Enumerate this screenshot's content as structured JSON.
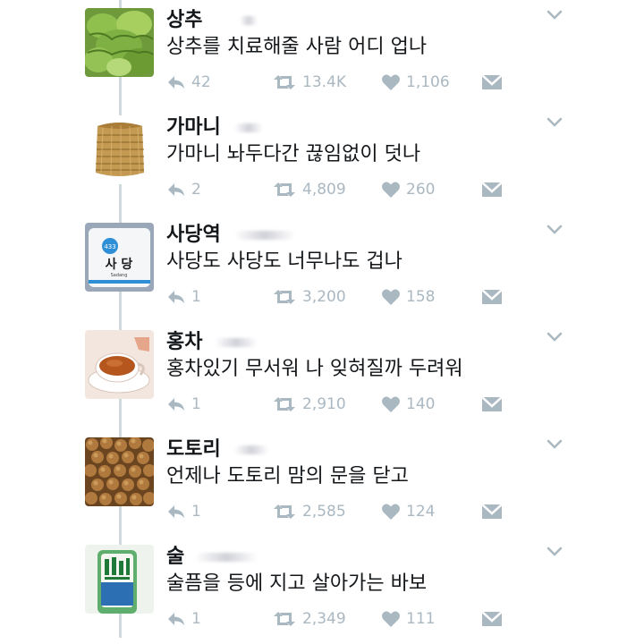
{
  "tweets": [
    {
      "name": "상추",
      "text": "상추를 치료해줄 사람 어디 업나",
      "replies": "42",
      "retweets": "13.4K",
      "likes": "1,106",
      "avatar": "lettuce"
    },
    {
      "name": "가마니",
      "text": "가마니 놔두다간 끊임없이 덧나",
      "replies": "2",
      "retweets": "4,809",
      "likes": "260",
      "avatar": "straw-sack"
    },
    {
      "name": "사당역",
      "text": "사당도 사당도 너무나도 겁나",
      "replies": "1",
      "retweets": "3,200",
      "likes": "158",
      "avatar": "station-sign",
      "sign": {
        "number": "433",
        "korean": "사 당",
        "romanized": "Sadang"
      }
    },
    {
      "name": "홍차",
      "text": "홍차있기 무서워 나 잊혀질까 두려워",
      "replies": "1",
      "retweets": "2,910",
      "likes": "140",
      "avatar": "black-tea"
    },
    {
      "name": "도토리",
      "text": "언제나 도토리 맘의 문을 닫고",
      "replies": "1",
      "retweets": "2,585",
      "likes": "124",
      "avatar": "acorns"
    },
    {
      "name": "술",
      "text": "술픔을 등에 지고 살아가는 바보",
      "replies": "1",
      "retweets": "2,349",
      "likes": "111",
      "avatar": "soju-bottle"
    }
  ],
  "colors": {
    "text": "#14171a",
    "icon": "#aab8c2",
    "thread_line": "#cfd9de"
  },
  "icons": {
    "reply": "reply-icon",
    "retweet": "retweet-icon",
    "like": "heart-icon",
    "message": "envelope-icon",
    "menu": "chevron-down-icon"
  }
}
